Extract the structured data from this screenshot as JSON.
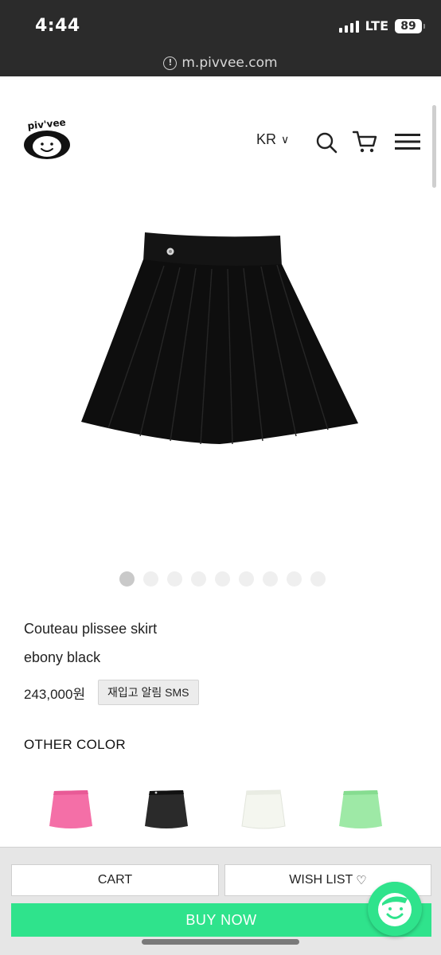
{
  "status_bar": {
    "time": "4:44",
    "network": "LTE",
    "battery": "89"
  },
  "url_bar": {
    "url": "m.pivvee.com"
  },
  "header": {
    "logo_text": "piv'vee",
    "language": "KR",
    "icons": [
      "search-icon",
      "cart-icon",
      "hamburger-menu-icon"
    ]
  },
  "product": {
    "name": "Couteau plissee skirt",
    "color": "ebony black",
    "price": "243,000원",
    "restock_button": "재입고 알림 SMS",
    "image_count": 9,
    "active_image": 1
  },
  "other_color": {
    "title": "OTHER COLOR",
    "swatches": [
      {
        "name": "pink",
        "color": "#f46fa7"
      },
      {
        "name": "black",
        "color": "#2a2a2a"
      },
      {
        "name": "white",
        "color": "#f4f6ef"
      },
      {
        "name": "mint",
        "color": "#9ee9a6"
      }
    ]
  },
  "actions": {
    "cart": "CART",
    "wish_list": "WISH LIST",
    "buy_now": "BUY NOW"
  },
  "colors": {
    "accent": "#2fe38c",
    "status_bg": "#2b2b2b"
  }
}
